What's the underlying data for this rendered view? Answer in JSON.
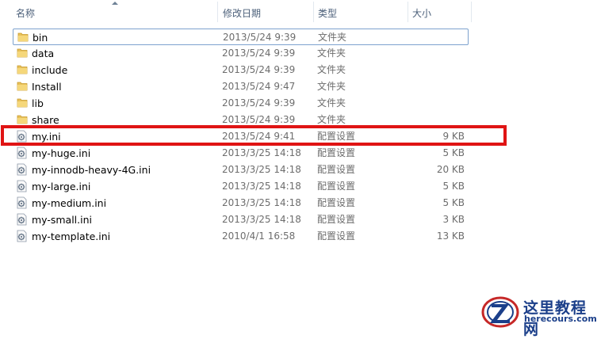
{
  "columns": {
    "name": "名称",
    "date": "修改日期",
    "type": "类型",
    "size": "大小"
  },
  "files": [
    {
      "name": "bin",
      "date": "2013/5/24 9:39",
      "type": "文件夹",
      "size": "",
      "icon": "folder-icon"
    },
    {
      "name": "data",
      "date": "2013/5/24 9:39",
      "type": "文件夹",
      "size": "",
      "icon": "folder-icon"
    },
    {
      "name": "include",
      "date": "2013/5/24 9:39",
      "type": "文件夹",
      "size": "",
      "icon": "folder-icon"
    },
    {
      "name": "Install",
      "date": "2013/5/24 9:47",
      "type": "文件夹",
      "size": "",
      "icon": "folder-icon"
    },
    {
      "name": "lib",
      "date": "2013/5/24 9:39",
      "type": "文件夹",
      "size": "",
      "icon": "folder-icon"
    },
    {
      "name": "share",
      "date": "2013/5/24 9:39",
      "type": "文件夹",
      "size": "",
      "icon": "folder-icon"
    },
    {
      "name": "my.ini",
      "date": "2013/5/24 9:41",
      "type": "配置设置",
      "size": "9 KB",
      "icon": "config-file-icon"
    },
    {
      "name": "my-huge.ini",
      "date": "2013/3/25 14:18",
      "type": "配置设置",
      "size": "5 KB",
      "icon": "config-file-icon"
    },
    {
      "name": "my-innodb-heavy-4G.ini",
      "date": "2013/3/25 14:18",
      "type": "配置设置",
      "size": "20 KB",
      "icon": "config-file-icon"
    },
    {
      "name": "my-large.ini",
      "date": "2013/3/25 14:18",
      "type": "配置设置",
      "size": "5 KB",
      "icon": "config-file-icon"
    },
    {
      "name": "my-medium.ini",
      "date": "2013/3/25 14:18",
      "type": "配置设置",
      "size": "5 KB",
      "icon": "config-file-icon"
    },
    {
      "name": "my-small.ini",
      "date": "2013/3/25 14:18",
      "type": "配置设置",
      "size": "3 KB",
      "icon": "config-file-icon"
    },
    {
      "name": "my-template.ini",
      "date": "2010/4/1 16:58",
      "type": "配置设置",
      "size": "13 KB",
      "icon": "config-file-icon"
    }
  ],
  "selected_row": 0,
  "highlighted_row": 6,
  "colors": {
    "highlight_box": "#e01414",
    "selection_border": "#7da2ce",
    "folder": "#e8c15a",
    "watermark": "#1b3f8a"
  },
  "watermark": {
    "text": "这里教程网",
    "url": "herecours.com"
  }
}
